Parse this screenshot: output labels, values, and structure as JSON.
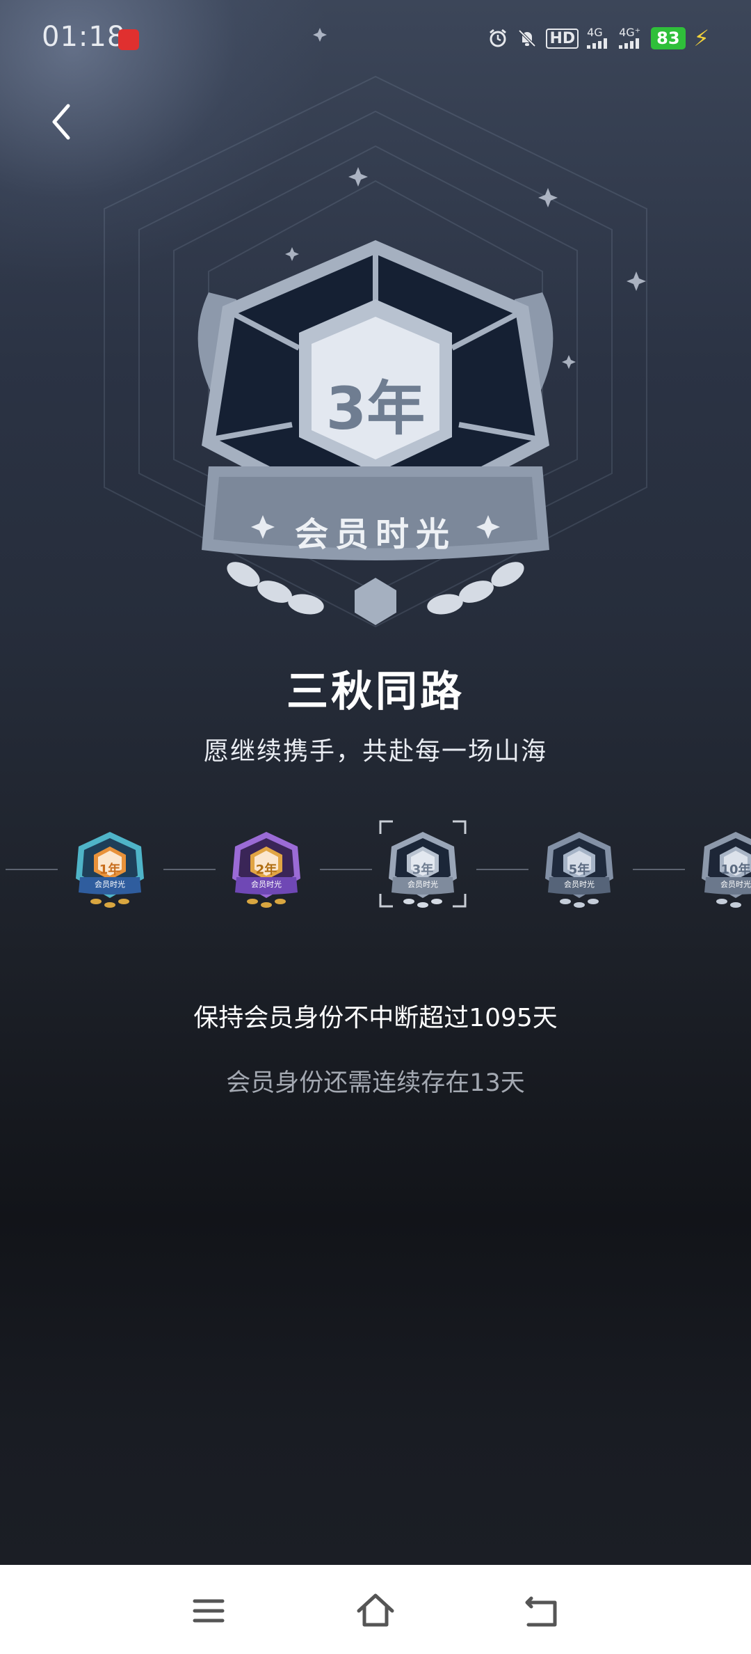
{
  "status_bar": {
    "time": "01:18",
    "battery": "83",
    "network_1": "4G",
    "network_2": "4G⁺",
    "hd_label": "HD",
    "icons": [
      "alarm-icon",
      "mute-bell-icon",
      "hd-icon",
      "signal-icon",
      "signal-icon",
      "battery-icon",
      "charging-icon"
    ]
  },
  "hero_badge": {
    "year_label": "3年",
    "ribbon_text": "会员时光"
  },
  "achievement": {
    "title": "三秋同路",
    "subtitle": "愿继续携手，共赴每一场山海"
  },
  "timeline": {
    "badges": [
      {
        "label": "1年",
        "state": "earned",
        "color": "#e8923a"
      },
      {
        "label": "2年",
        "state": "earned",
        "color": "#a86ee0"
      },
      {
        "label": "3年",
        "state": "selected",
        "color": "#9aa6b8"
      },
      {
        "label": "5年",
        "state": "locked",
        "color": "#8391a6"
      },
      {
        "label": "10年",
        "state": "locked",
        "color": "#8d99ab"
      }
    ],
    "ribbon_text": "会员时光"
  },
  "requirement": {
    "condition": "保持会员身份不中断超过1095天",
    "remaining": "会员身份还需连续存在13天"
  },
  "nav_bar": {
    "icons": [
      "menu-icon",
      "home-icon",
      "back-icon"
    ]
  }
}
